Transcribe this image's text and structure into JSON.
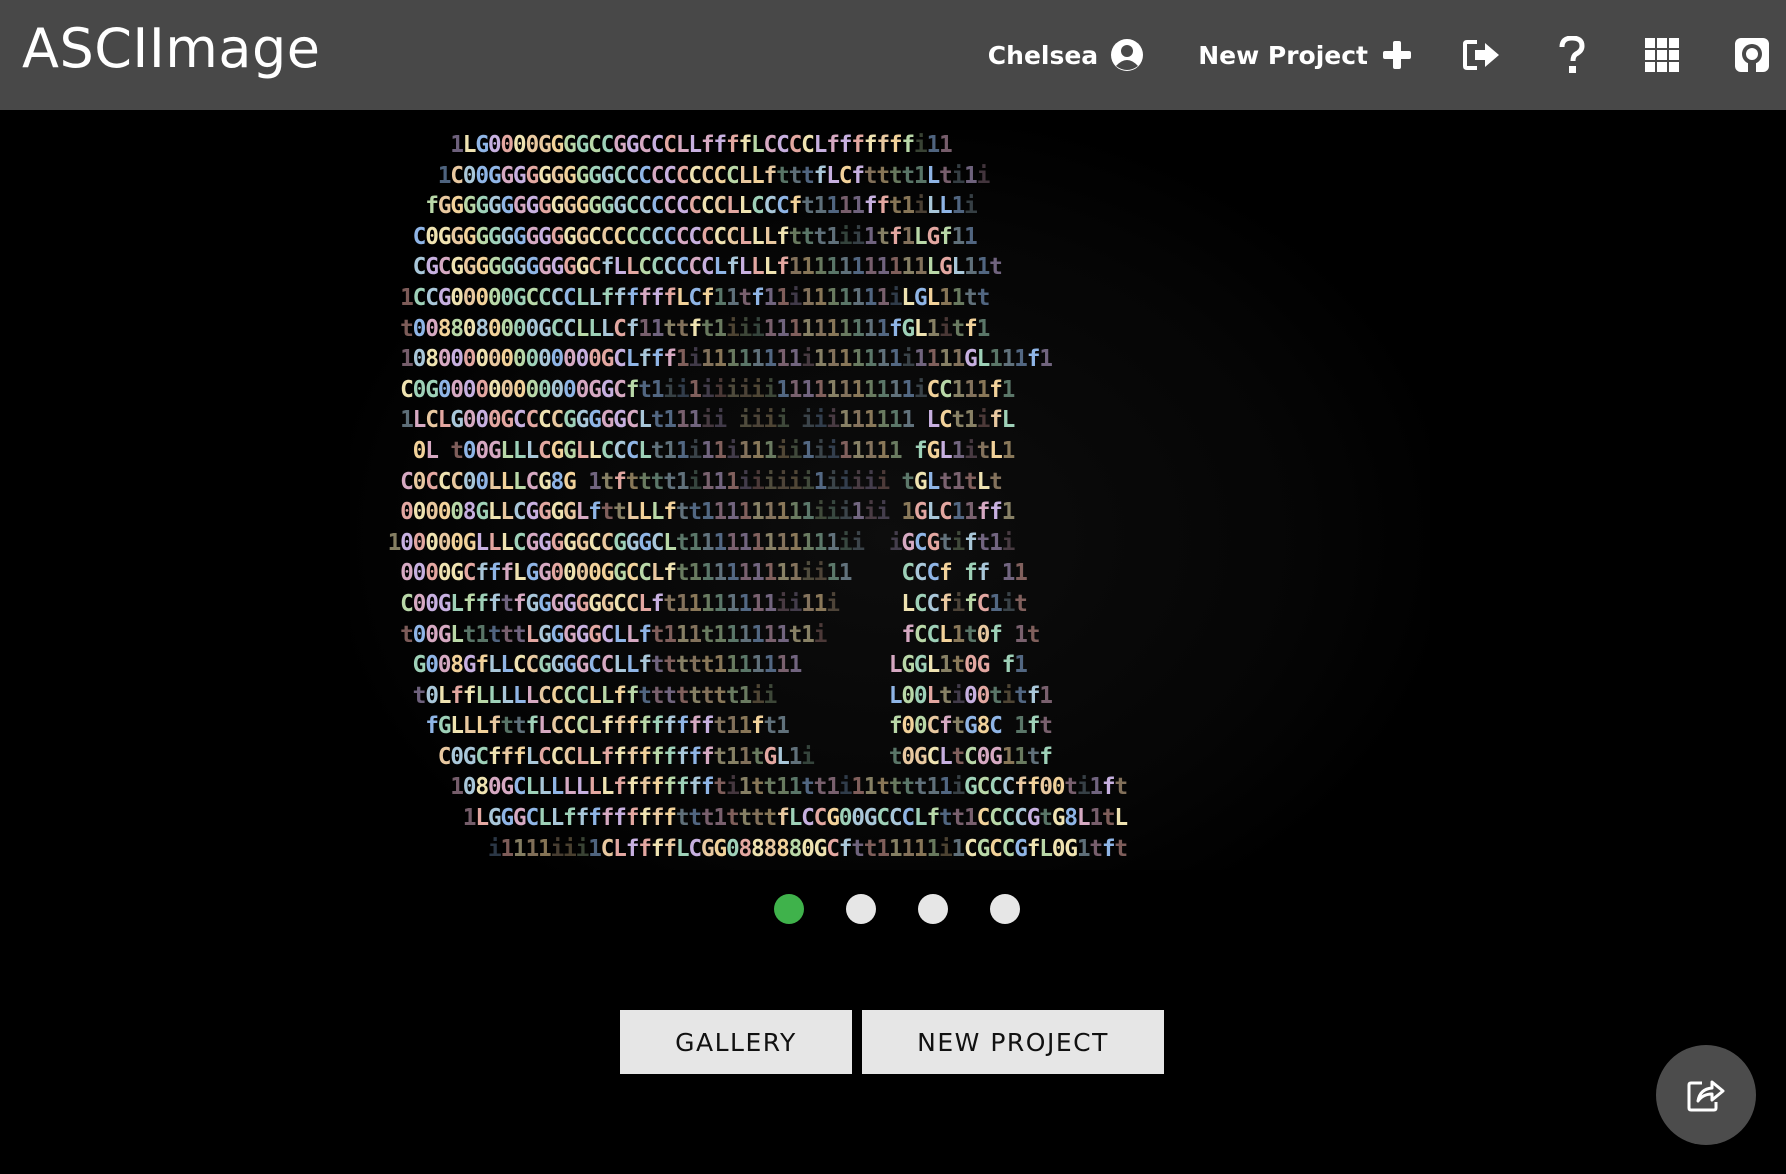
{
  "navbar": {
    "brand": "ASCIImage",
    "user_name": "Chelsea",
    "new_project_label": "New Project",
    "icons": [
      "user-circle-icon",
      "plus-icon",
      "sign-out-icon",
      "question-icon",
      "grid-icon",
      "github-icon"
    ]
  },
  "art": {
    "lines": [
      "        1LG0000GGGGCCGGCCCLLffffLCCCCLfffffffi11",
      "       1C00GGGGGGGGGGCCCCCCCCCCLLftttfLCftttt1Lti1i",
      "      fGGGGGGGGGGGGGGGCCCCCCCCLLCCCft1111fft1iLL1i",
      "     C0GGGGGGGGGGGGCCCCCCCCCCCCLLLfttt1ii1tf1LGf11",
      "     CGCGGGGGGGGGGGCfLLCCCCCCLfLLLf11111111111LGL11t",
      "    1CCG00000GCCCCLLffffffLCf11tf11i1111111iLGL11tt",
      "    t0088080000GCCLLLCf11ttft1iii1111111111fGL1itf1",
      "    1080000000000000GCLfff1i11111111i1111111i1111GL111f1",
      "    C0G000000000000GGCft1ii1iiiiii11111111111iCC111f1",
      "    1LCLG000GCCCCGGGGGCLt111ii iiii iii111111 LCt1ifL",
      "     0L t00GLLLCGGLLCCCLt11i11i111ii1ii11111 fGL1itL1",
      "    C0CCC00LLLCG8G 1tftttt1i111iiiiii1iiiii tGLt1tLt",
      "    000008GLLCGGGGLfttLLLftt111111111iii1ii 1GLC11ff1",
      "   100000GLLLCGGGGGCCGGGCLt111111111111ii  iGCGtift1i",
      "    0000GCfffLGG0000GGCCLft111111111ii11    CCCf ff 11",
      "    C00GLffftfGGGGGGGCCLft11111111ii11i     LCCfifC1it",
      "    t00GLt1tttLGGGGGCLLft111t111111t1i      fCCL1t0f 1t",
      "     G008GfLLCCGGGGCCLLfttttt1111111       LGGL1t0G f1",
      "     t0LffLLLLLCCCCLLfftttttttt1ii         L00Lti00titf1",
      "      fGLLLfttfLCCCLffffffffft11ft1        f00CftG8C 1ft",
      "       C0GCfffLCCCLLffffffffft11tGL1i      t0GCLtC0G11tf",
      "        1080GCLLLLLLLffffffffti1tt11tt1i11tttt11iGCCCff00ti1ft",
      "         1LGGGCLLfffffffffttt1ttttfLCCG00GCCCLftt1CCCCGtG8L1tL",
      "           i1111iii1CLffffLCGG0888880GCftt11111i1CGCCGfL0G1tft"
    ],
    "palette": [
      "#b9d8a8",
      "#8fb5e6",
      "#e3a7a1",
      "#f2d29a",
      "#a9c7d9",
      "#c7b0e0",
      "#e8c8a0",
      "#9ed1b8",
      "#d6a9c2",
      "#efe3b1"
    ]
  },
  "slider": {
    "count": 4,
    "active_index": 0,
    "active_color": "#3fb24b"
  },
  "actions": {
    "gallery_label": "GALLERY",
    "new_project_label": "NEW PROJECT"
  },
  "fab": {
    "icon": "share-icon"
  }
}
